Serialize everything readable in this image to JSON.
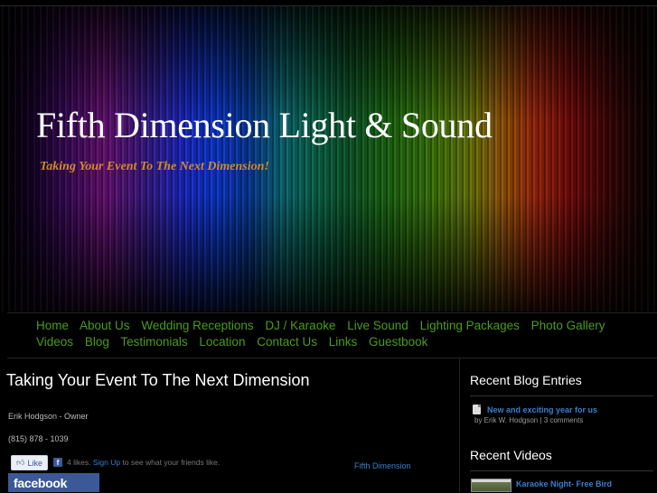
{
  "header": {
    "site_title": "Fifth Dimension Light & Sound",
    "tagline": "Taking Your Event To The Next Dimension!"
  },
  "nav": {
    "items": [
      "Home",
      "About Us",
      "Wedding Receptions",
      "DJ / Karaoke",
      "Live Sound",
      "Lighting Packages",
      "Photo Gallery",
      "Videos",
      "Blog",
      "Testimonials",
      "Location",
      "Contact Us",
      "Links",
      "Guestbook"
    ],
    "color": "#4e9a1e"
  },
  "main": {
    "title": "Taking Your Event To The Next Dimension",
    "owner": "Erik Hodgson - Owner",
    "phone": "(815) 878 - 1039",
    "facebook": {
      "like_label": "Like",
      "likes_count": "4 likes.",
      "signup_label": "Sign Up",
      "signup_suffix": "to see what your friends like.",
      "banner": "facebook",
      "page_link": "Fifth Dimension"
    }
  },
  "sidebar": {
    "blog_heading": "Recent Blog Entries",
    "blog_entry": {
      "title": "New and exciting year for us",
      "author": "by Erik W. Hodgson",
      "comments": "3 comments"
    },
    "videos_heading": "Recent Videos",
    "video_entry": {
      "title": "Karaoke Night- Free Bird"
    }
  },
  "colors": {
    "link": "#3b7fd0",
    "tagline": "#d08a2a",
    "background": "#000000"
  }
}
